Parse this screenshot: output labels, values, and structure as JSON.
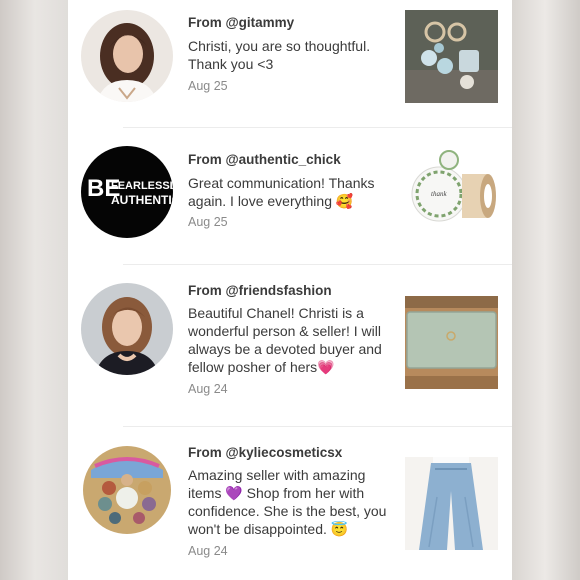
{
  "reviews": [
    {
      "from": "From @gitammy",
      "message": "Christi, you are so thoughtful. Thank you <3",
      "date": "Aug 25",
      "avatar_icon": "woman-portrait",
      "thumbnail_icon": "keychain-photo"
    },
    {
      "from": "From @authentic_chick",
      "message": "Great communication! Thanks again. I love everything 🥰",
      "date": "Aug 25",
      "avatar_icon": "logo-avatar",
      "avatar_text_line1": "FEARLESSLY",
      "avatar_text_line2": "AUTHENTIC",
      "thumbnail_icon": "sticker-roll-photo"
    },
    {
      "from": "From @friendsfashion",
      "message": "Beautiful Chanel! Christi is a wonderful person & seller! I will always be a devoted buyer and fellow posher of hers💗",
      "date": "Aug 24",
      "avatar_icon": "woman-portrait",
      "thumbnail_icon": "wallet-photo"
    },
    {
      "from": "From @kyliecosmeticsx",
      "message": "Amazing seller with amazing items 💜 Shop from her with confidence. She is the best, you won't be disappointed. 😇",
      "date": "Aug 24",
      "avatar_icon": "eyeshadow-palette",
      "thumbnail_icon": "pants-photo"
    }
  ],
  "colors": {
    "text": "#3b3b3b",
    "date": "#8a8a8a",
    "divider": "#ececec"
  }
}
